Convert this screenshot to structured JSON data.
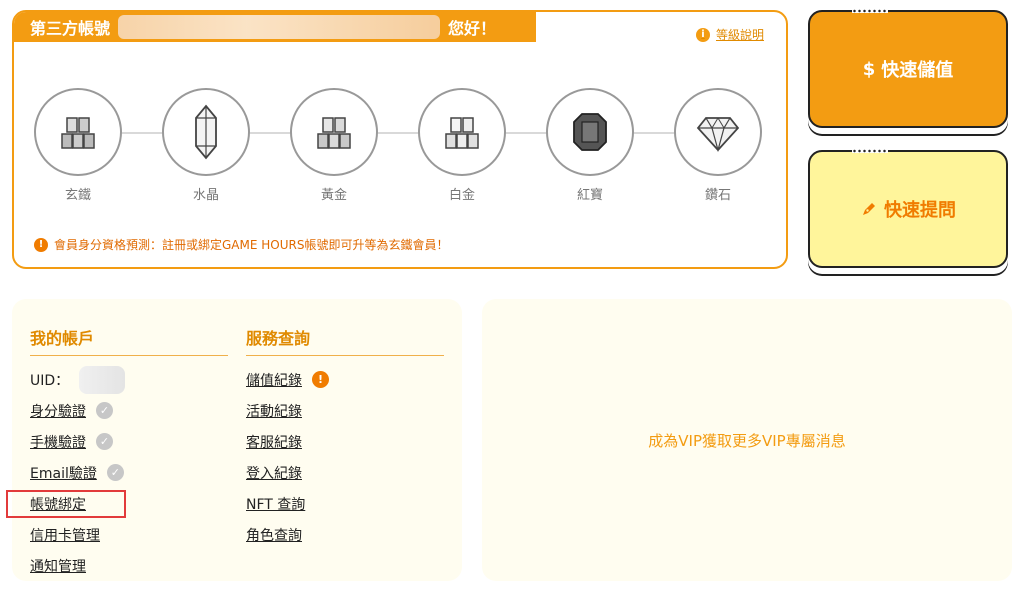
{
  "greeting": {
    "prefix": "第三方帳號",
    "suffix": "您好！"
  },
  "level_help": {
    "icon": "info-icon",
    "label": "等級說明"
  },
  "levels": [
    {
      "label": "玄鐵",
      "icon": "iron-bars-icon"
    },
    {
      "label": "水晶",
      "icon": "crystal-icon"
    },
    {
      "label": "黃金",
      "icon": "gold-bars-icon"
    },
    {
      "label": "白金",
      "icon": "platinum-bars-icon"
    },
    {
      "label": "紅寶",
      "icon": "ruby-icon"
    },
    {
      "label": "鑽石",
      "icon": "diamond-icon"
    }
  ],
  "notice": {
    "icon": "warning-icon",
    "text": "會員身分資格預測：註冊或綁定GAME HOURS帳號即可升等為玄鐵會員！"
  },
  "actions": {
    "deposit": {
      "icon": "dollar-icon",
      "label": "快速儲值"
    },
    "ask": {
      "icon": "pen-icon",
      "label": "快速提問"
    }
  },
  "account": {
    "title": "我的帳戶",
    "uid_label": "UID：",
    "items": [
      {
        "label": "身分驗證",
        "verified": true
      },
      {
        "label": "手機驗證",
        "verified": true
      },
      {
        "label": "Email驗證",
        "verified": true
      },
      {
        "label": "帳號綁定",
        "verified": false
      },
      {
        "label": "信用卡管理",
        "verified": false
      },
      {
        "label": "通知管理",
        "verified": false
      }
    ]
  },
  "service": {
    "title": "服務查詢",
    "items": [
      {
        "label": "儲值紀錄",
        "alert": true
      },
      {
        "label": "活動紀錄",
        "alert": false
      },
      {
        "label": "客服紀錄",
        "alert": false
      },
      {
        "label": "登入紀錄",
        "alert": false
      },
      {
        "label": "NFT 查詢",
        "alert": false
      },
      {
        "label": "角色查詢",
        "alert": false
      }
    ]
  },
  "vip": {
    "message": "成為VIP獲取更多VIP專屬消息"
  },
  "colors": {
    "accent": "#f39c12",
    "ask_bg": "#fff59b",
    "panel_bg": "#fffdf0",
    "highlight": "#e23b3b"
  }
}
